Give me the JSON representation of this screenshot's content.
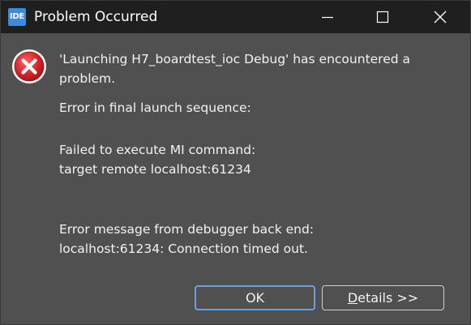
{
  "window": {
    "app_icon_text": "IDE",
    "title": "Problem Occurred"
  },
  "icons": {
    "app": "ide-app-icon",
    "minimize": "minimize-icon",
    "maximize": "maximize-icon",
    "close": "close-icon",
    "error": "error-icon"
  },
  "message": {
    "headline_line1": "'Launching H7_boardtest_ioc Debug' has encountered a",
    "headline_line2": "problem.",
    "line1": "Error in final launch sequence:",
    "line2": "Failed to execute MI command:",
    "line3": "target remote localhost:61234",
    "line4": "Error message from debugger back end:",
    "line5": "localhost:61234: Connection timed out."
  },
  "buttons": {
    "ok_label": "OK",
    "details_mnemonic": "D",
    "details_rest": "etails >>"
  },
  "colors": {
    "titlebar_bg": "#1f1f1f",
    "dialog_bg": "#505050",
    "error_red": "#d8232a",
    "focus_border": "#6aa0e0",
    "app_icon_blue": "#3a8dde"
  }
}
